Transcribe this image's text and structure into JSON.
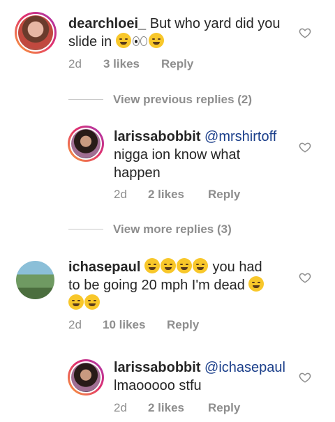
{
  "comments": [
    {
      "username": "dearchloei_",
      "text_line1": " But who yard did you",
      "text_line2": "slide in ",
      "time": "2d",
      "likes": "3 likes",
      "reply": "Reply"
    },
    {
      "username": "larissabobbit",
      "mention": " @mrshirtoff",
      "text_line1": "nigga ion know what",
      "text_line2": "happen",
      "time": "2d",
      "likes": "2 likes",
      "reply": "Reply"
    },
    {
      "username": "ichasepaul",
      "text_line1": " you had",
      "text_line2": "to be going 20 mph I'm dead ",
      "time": "2d",
      "likes": "10 likes",
      "reply": "Reply"
    },
    {
      "username": "larissabobbit",
      "mention": " @ichasepaul",
      "text_line1": "lmaooooo stfu",
      "time": "2d",
      "likes": "2 likes",
      "reply": "Reply"
    }
  ],
  "view_previous": "View previous replies (2)",
  "view_more": "View more replies (3)",
  "icons": {
    "like": "heart-outline-icon",
    "laugh_emoji": "rolling-on-floor-laughing-emoji",
    "eyes_emoji": "eyes-emoji",
    "weary_emoji": "weary-face-emoji"
  },
  "colors": {
    "text": "#262626",
    "meta": "#8e8e8e",
    "mention": "#1a3e8a"
  }
}
